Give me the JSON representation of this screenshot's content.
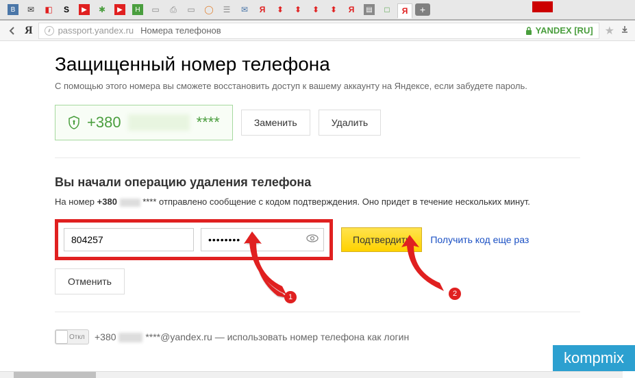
{
  "browser": {
    "url_path": "passport.yandex.ru",
    "url_title": "Номера телефонов",
    "security_badge": "YANDEX [RU]",
    "new_tab": "+",
    "ya_letter": "Я"
  },
  "page": {
    "title": "Защищенный номер телефона",
    "subtitle": "С помощью этого номера вы сможете восстановить доступ к вашему аккаунту на Яндексе, если забудете пароль."
  },
  "phone": {
    "prefix": "+380",
    "masked": "****",
    "replace_btn": "Заменить",
    "delete_btn": "Удалить"
  },
  "delete_op": {
    "title": "Вы начали операцию удаления телефона",
    "msg_prefix": "На номер ",
    "msg_phone_bold": "+380",
    "msg_masked": " **** ",
    "msg_suffix": "отправлено сообщение с кодом подтверждения. Оно придет в течение нескольких минут.",
    "code_value": "804257",
    "password_value": "••••••••",
    "confirm_btn": "Подтвердить",
    "resend_link": "Получить код еще раз",
    "cancel_btn": "Отменить"
  },
  "login": {
    "toggle_label": "Откл",
    "phone_prefix": "+380",
    "phone_masked": "****",
    "domain": "@yandex.ru",
    "text": " — использовать номер телефона как логин"
  },
  "annotations": {
    "num1": "1",
    "num2": "2"
  },
  "watermark": "kompmix"
}
